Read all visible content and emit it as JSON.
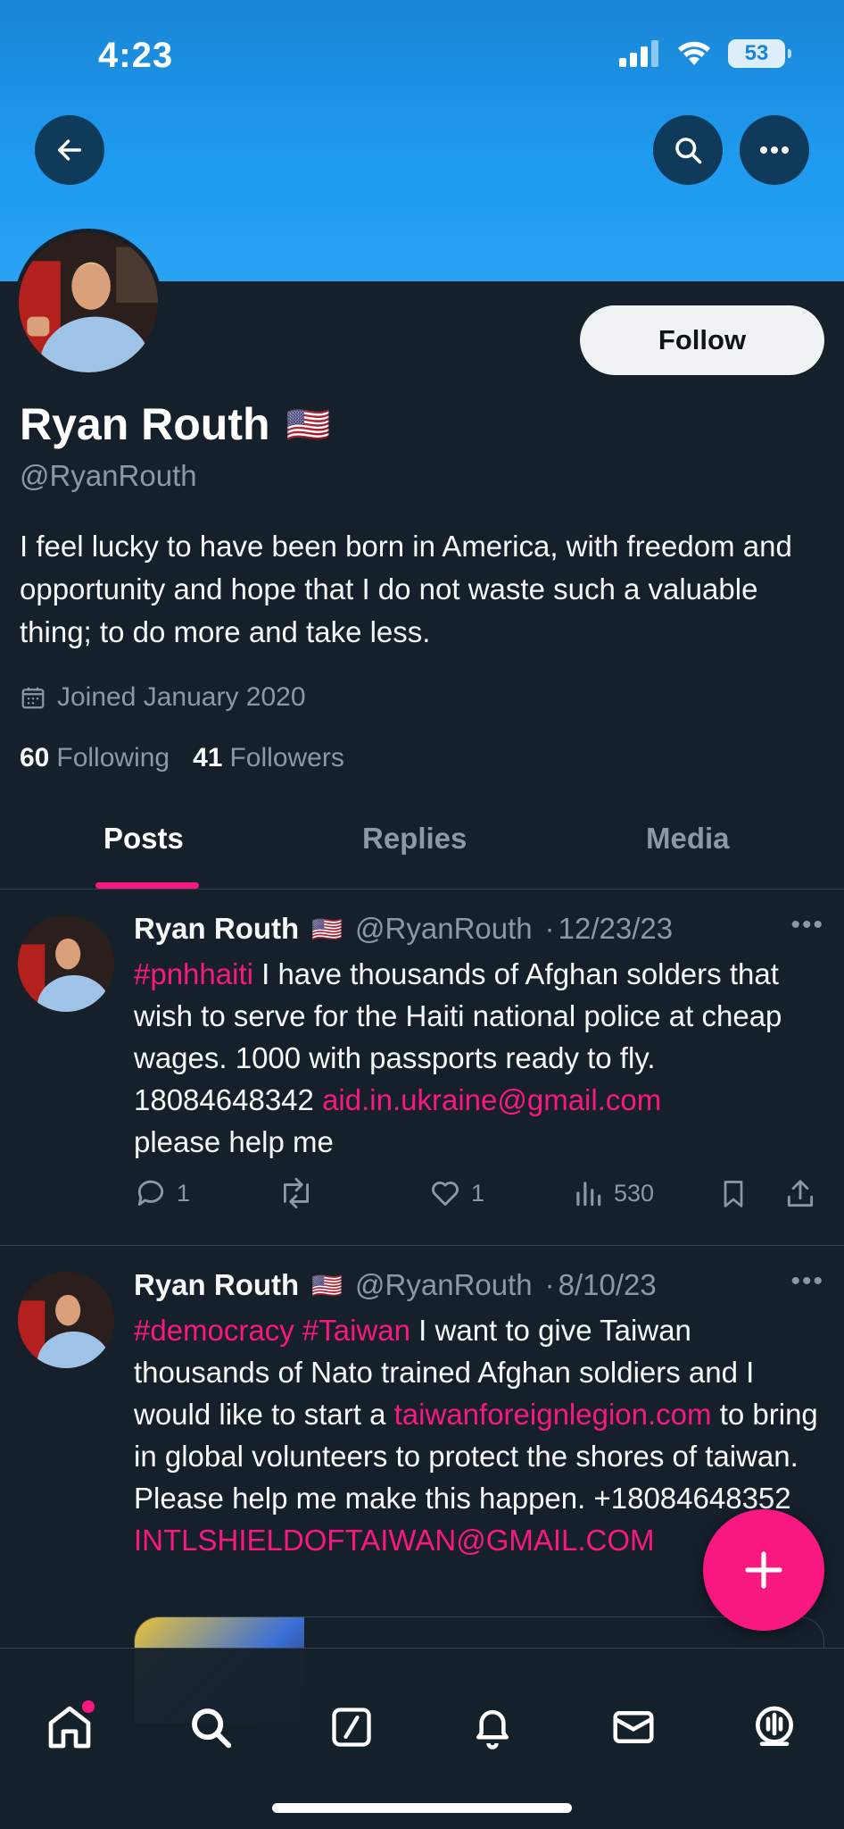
{
  "status_bar": {
    "time": "4:23",
    "battery": "53"
  },
  "profile": {
    "name": "Ryan Routh",
    "flag": "🇺🇸",
    "handle": "@RyanRouth",
    "bio": "I feel lucky to have been born in America, with freedom and opportunity and hope that I do not waste such a valuable thing; to do more and take less.",
    "joined": "Joined January 2020",
    "following_count": "60",
    "following_label": "Following",
    "followers_count": "41",
    "followers_label": "Followers",
    "follow_label": "Follow"
  },
  "tabs": [
    {
      "label": "Posts",
      "active": true
    },
    {
      "label": "Replies",
      "active": false
    },
    {
      "label": "Media",
      "active": false
    }
  ],
  "posts": [
    {
      "name": "Ryan Routh",
      "flag": "🇺🇸",
      "handle": "@RyanRouth",
      "date": "12/23/23",
      "hashtag": "#pnhhaiti",
      "text_1": " I have thousands of Afghan solders that wish to serve for the Haiti national police at cheap wages. 1000 with passports ready to fly. 18084648342 ",
      "email": "aid.in.ukraine@gmail.com",
      "text_2": "please help me",
      "replies": "1",
      "likes": "1",
      "views": "530"
    },
    {
      "name": "Ryan Routh",
      "flag": "🇺🇸",
      "handle": "@RyanRouth",
      "date": "8/10/23",
      "hashtag_1": "#democracy",
      "hashtag_2": "#Taiwan",
      "text_1": " I want to give Taiwan thousands of Nato trained Afghan soldiers and I would like to start a ",
      "link": "taiwanforeignlegion.com",
      "text_2": " to bring in global volunteers to protect the shores of taiwan.    Please help me make this happen. +18084648352",
      "email": "INTLSHIELDOFTAIWAN@GMAIL.COM"
    }
  ],
  "colors": {
    "accent": "#f91880",
    "banner": "#1e9bf0",
    "background": "#15202b"
  },
  "icons": {
    "back": "arrow-left-icon",
    "search": "search-icon",
    "more": "more-horizontal-icon",
    "compose": "plus-icon",
    "home": "home-icon",
    "explore": "search-icon",
    "grok": "slash-square-icon",
    "notifications": "bell-icon",
    "messages": "mail-icon",
    "spaces": "spaces-icon"
  }
}
